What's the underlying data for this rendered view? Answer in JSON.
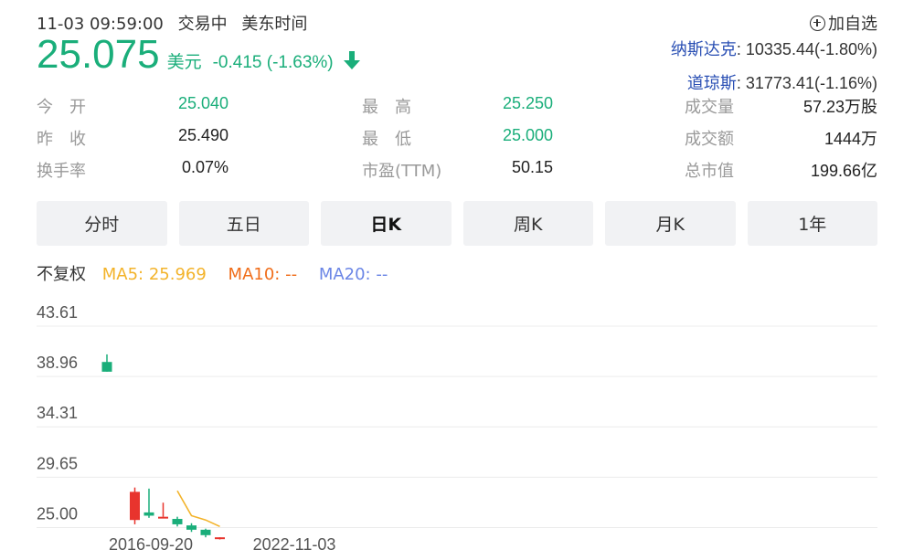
{
  "header": {
    "datetime": "11-03 09:59:00",
    "status": "交易中",
    "timezone": "美东时间",
    "watch_label": "加自选",
    "watch_icon": "plus-circle-icon"
  },
  "quote": {
    "price": "25.075",
    "currency": "美元",
    "change": "-0.415 (-1.63%)",
    "direction_icon": "arrow-down-icon"
  },
  "indices": [
    {
      "name": "纳斯达克",
      "value": ": 10335.44(-1.80%)"
    },
    {
      "name": "道琼斯",
      "value": ": 31773.41(-1.16%)"
    }
  ],
  "stats": [
    [
      {
        "label": "今　开",
        "value": "25.040",
        "color": "green"
      },
      {
        "label": "最　高",
        "value": "25.250",
        "color": "green"
      },
      {
        "label": "成交量",
        "value": "57.23万股",
        "color": "dark"
      }
    ],
    [
      {
        "label": "昨　收",
        "value": "25.490",
        "color": "dark"
      },
      {
        "label": "最　低",
        "value": "25.000",
        "color": "green"
      },
      {
        "label": "成交额",
        "value": "1444万",
        "color": "dark"
      }
    ],
    [
      {
        "label": "换手率",
        "value": "0.07%",
        "color": "dark"
      },
      {
        "label": "市盈(TTM)",
        "value": "50.15",
        "color": "dark"
      },
      {
        "label": "总市值",
        "value": "199.66亿",
        "color": "dark"
      }
    ]
  ],
  "tabs": [
    {
      "label": "分时",
      "active": false
    },
    {
      "label": "五日",
      "active": false
    },
    {
      "label": "日K",
      "active": true
    },
    {
      "label": "周K",
      "active": false
    },
    {
      "label": "月K",
      "active": false
    },
    {
      "label": "1年",
      "active": false
    }
  ],
  "ma": {
    "fq_label": "不复权",
    "ma5": "MA5: 25.969",
    "ma10": "MA10: --",
    "ma20": "MA20: --"
  },
  "colors": {
    "up": "#e8342d",
    "down": "#1aae7a",
    "ma5": "#f3b32a",
    "grid": "#ececec",
    "axis_text": "#555555"
  },
  "chart_data": {
    "type": "candlestick",
    "ylim": [
      23.9,
      43.61
    ],
    "y_ticks": [
      "43.61",
      "38.96",
      "34.31",
      "29.65",
      "25.00"
    ],
    "x_ticks": [
      "2016-09-20",
      "2022-11-03"
    ],
    "candles": [
      {
        "open": 40.3,
        "close": 39.4,
        "high": 41.0,
        "low": 39.4
      },
      {
        "open": 25.7,
        "close": 28.3,
        "high": 28.7,
        "low": 25.3
      },
      {
        "open": 26.4,
        "close": 26.1,
        "high": 28.6,
        "low": 25.9
      },
      {
        "open": 26.0,
        "close": 26.0,
        "high": 27.3,
        "low": 26.0
      },
      {
        "open": 25.8,
        "close": 25.3,
        "high": 26.0,
        "low": 25.1
      },
      {
        "open": 25.2,
        "close": 24.8,
        "high": 25.4,
        "low": 24.6
      },
      {
        "open": 24.8,
        "close": 24.3,
        "high": 24.9,
        "low": 24.1
      },
      {
        "open": 24.0,
        "close": 24.1,
        "high": 24.1,
        "low": 23.9
      }
    ],
    "ma5_line": [
      null,
      null,
      null,
      null,
      28.4,
      26.1,
      25.7,
      25.1
    ]
  }
}
